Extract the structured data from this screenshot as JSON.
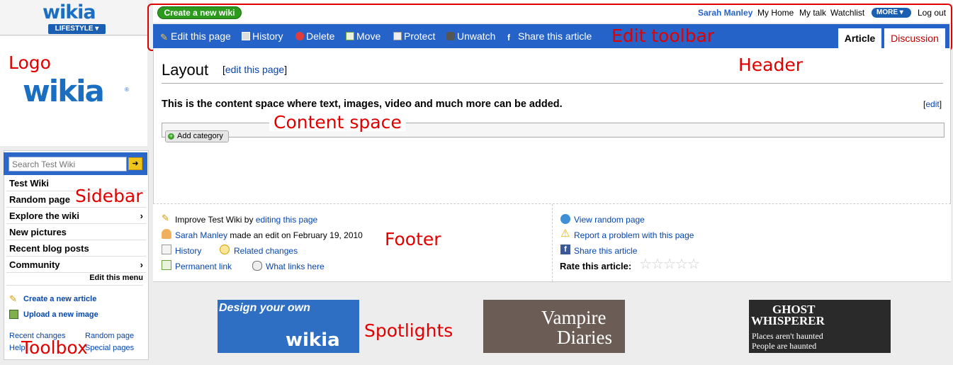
{
  "annotations": {
    "logo": "Logo",
    "sidebar": "Sidebar",
    "toolbox": "Toolbox",
    "edit_toolbar": "Edit toolbar",
    "header": "Header",
    "content_space": "Content space",
    "footer": "Footer",
    "spotlights": "Spotlights"
  },
  "brand": {
    "small_logo": "wikia",
    "hub": "LIFESTYLE ▾",
    "big_logo": "wikia",
    "registered": "®"
  },
  "header": {
    "create_wiki": "Create a new wiki",
    "user_links": [
      "Sarah Manley",
      "My Home",
      "My talk",
      "Watchlist"
    ],
    "more": "MORE ▾",
    "logout": "Log out"
  },
  "toolbar": {
    "buttons": [
      "Edit this page",
      "History",
      "Delete",
      "Move",
      "Protect",
      "Unwatch",
      "Share this article"
    ],
    "tab_article": "Article",
    "tab_discussion": "Discussion"
  },
  "sidebar": {
    "search_placeholder": "Search Test Wiki",
    "items": [
      {
        "label": "Test Wiki",
        "arrow": ""
      },
      {
        "label": "Random page",
        "arrow": ""
      },
      {
        "label": "Explore the wiki",
        "arrow": "›"
      },
      {
        "label": "New pictures",
        "arrow": ""
      },
      {
        "label": "Recent blog posts",
        "arrow": ""
      },
      {
        "label": "Community",
        "arrow": "›"
      }
    ],
    "edit_menu": "Edit this menu"
  },
  "toolbox": {
    "create_article": "Create a new article",
    "upload_image": "Upload a new image",
    "recent_changes": "Recent changes",
    "random_page": "Random page",
    "help": "Help",
    "special_pages": "Special pages"
  },
  "content": {
    "title": "Layout",
    "edit_page_open": "[",
    "edit_page": "edit this page",
    "edit_page_close": "]",
    "body": "This is the content space where text, images, video and much more can be added.",
    "edit_section_open": "[",
    "edit_section": "edit",
    "edit_section_close": "]",
    "add_category": "Add category"
  },
  "footer": {
    "improve_prefix": "Improve Test Wiki by",
    "improve_link": "editing this page",
    "editor": "Sarah Manley",
    "edit_info": "made an edit on February 19, 2010",
    "history": "History",
    "related": "Related changes",
    "permalink": "Permanent link",
    "what_links": "What links here",
    "view_random": "View random page",
    "report": "Report a problem with this page",
    "share": "Share this article",
    "rate_label": "Rate this article:",
    "rating_stars": 5
  },
  "spotlights": {
    "spot1_line1": "Design your own",
    "spot1_brand": "wikia",
    "spot2_title_1": "Vampire",
    "spot2_title_2": "Diaries",
    "spot3_title_1": "GHOST",
    "spot3_title_2": "WHISPERER",
    "spot3_tag_1": "Places aren't haunted",
    "spot3_tag_2": "People are haunted"
  },
  "colors": {
    "accent_blue": "#2663c9",
    "annotation_red": "#e00000",
    "create_green": "#2c9a1c"
  }
}
